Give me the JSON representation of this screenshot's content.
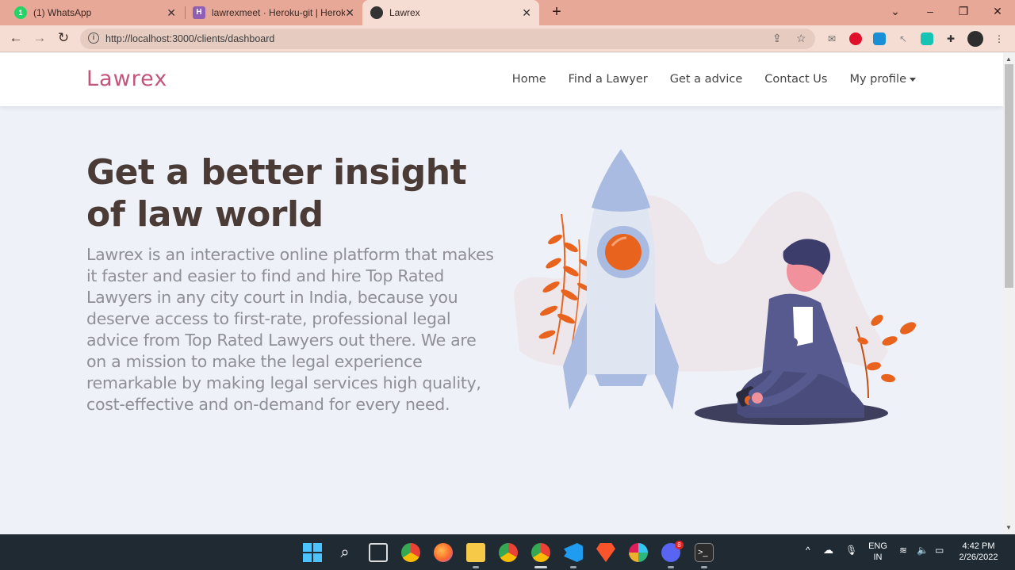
{
  "browser": {
    "tabs": [
      {
        "title": "(1) WhatsApp",
        "icon": "whatsapp-icon",
        "color": "#25d366"
      },
      {
        "title": "lawrexmeet · Heroku-git | Heroku",
        "icon": "heroku-icon",
        "color": "#8e5fb5"
      },
      {
        "title": "Lawrex",
        "icon": "globe-icon",
        "color": "#333333",
        "active": true
      }
    ],
    "url": "http://localhost:3000/clients/dashboard"
  },
  "site": {
    "brand": "Lawrex",
    "nav": {
      "home": "Home",
      "find": "Find a Lawyer",
      "advice": "Get a advice",
      "contact": "Contact Us",
      "profile": "My profile"
    },
    "hero": {
      "title": "Get a better insight of law world",
      "text": "Lawrex is an interactive online platform that makes it faster and easier to find and hire Top Rated Lawyers in any city court in India, because you deserve access to first-rate, professional legal advice from Top Rated Lawyers out there. We are on a mission to make the legal experience remarkable by making legal services high quality, cost-effective and on-demand for every need."
    },
    "colors": {
      "brand": "#c2557a",
      "heading": "#4a3b36",
      "body_text": "#8f8f95",
      "accent_orange": "#e8631e"
    }
  },
  "taskbar": {
    "language": "ENG",
    "region": "IN",
    "time": "4:42 PM",
    "date": "2/26/2022",
    "discord_badge": "8"
  }
}
